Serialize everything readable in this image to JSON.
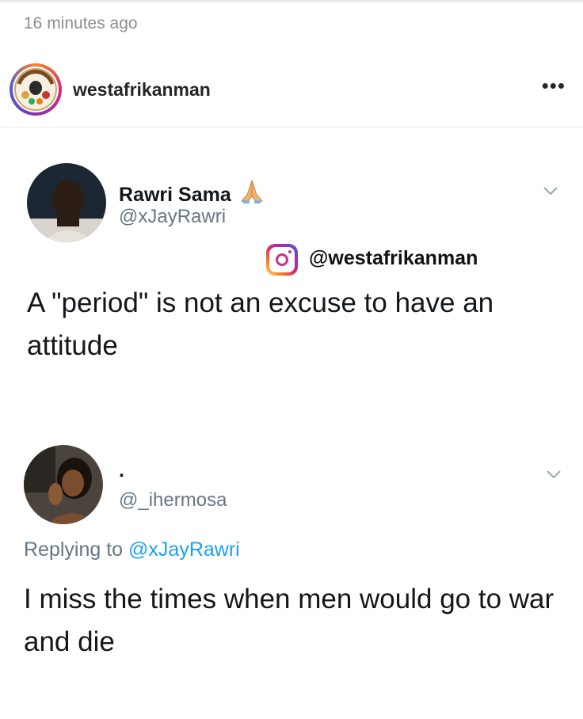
{
  "post": {
    "timestamp": "16 minutes ago",
    "username": "westafrikanman",
    "more_label": "•••"
  },
  "watermark": {
    "handle": "@westafrikanman",
    "icon": "instagram-icon"
  },
  "tweets": [
    {
      "name": "Rawri Sama",
      "name_emoji": "folded-hands-icon",
      "handle": "@xJayRawri",
      "text": "A \"period\" is not an excuse to have an attitude"
    },
    {
      "name": ".",
      "handle": "@_ihermosa",
      "replying_prefix": "Replying to ",
      "replying_to": "@xJayRawri",
      "text": "I miss the times when men would go to war and die"
    }
  ],
  "colors": {
    "handle_gray": "#657786",
    "link_blue": "#1da1f2",
    "text_dark": "#14171a"
  }
}
